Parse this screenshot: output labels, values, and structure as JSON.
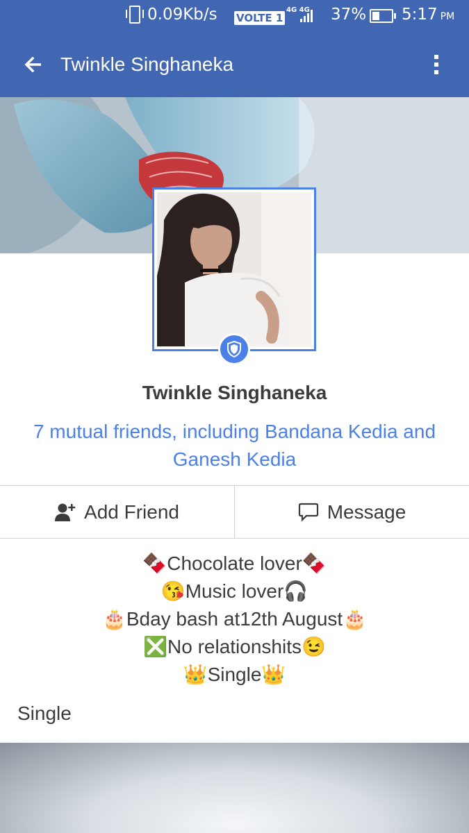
{
  "status_bar": {
    "net_speed": "0.09Kb/s",
    "volte_label": "VOLTE 1",
    "network_type": "4G 4G",
    "battery_percent": "37%",
    "time": "5:17",
    "ampm": "PM"
  },
  "app_bar": {
    "title": "Twinkle Singhaneka",
    "back_icon": "back-arrow-icon",
    "menu_icon": "overflow-menu-icon"
  },
  "profile": {
    "name": "Twinkle Singhaneka",
    "mutual_friends": "7 mutual friends, including Bandana Kedia and Ganesh Kedia",
    "badge_icon": "shield-icon"
  },
  "actions": {
    "add_friend_label": "Add Friend",
    "message_label": "Message"
  },
  "bio": {
    "lines": [
      "🍫Chocolate lover🍫",
      "😘Music lover🎧",
      "🎂Bday bash at12th August🎂",
      "❎No relationshits😉",
      "👑Single👑"
    ]
  },
  "relationship_status": "Single",
  "colors": {
    "brand_blue": "#4267b2",
    "link_blue": "#4a80e8",
    "text_dark": "#3a3b3c"
  }
}
